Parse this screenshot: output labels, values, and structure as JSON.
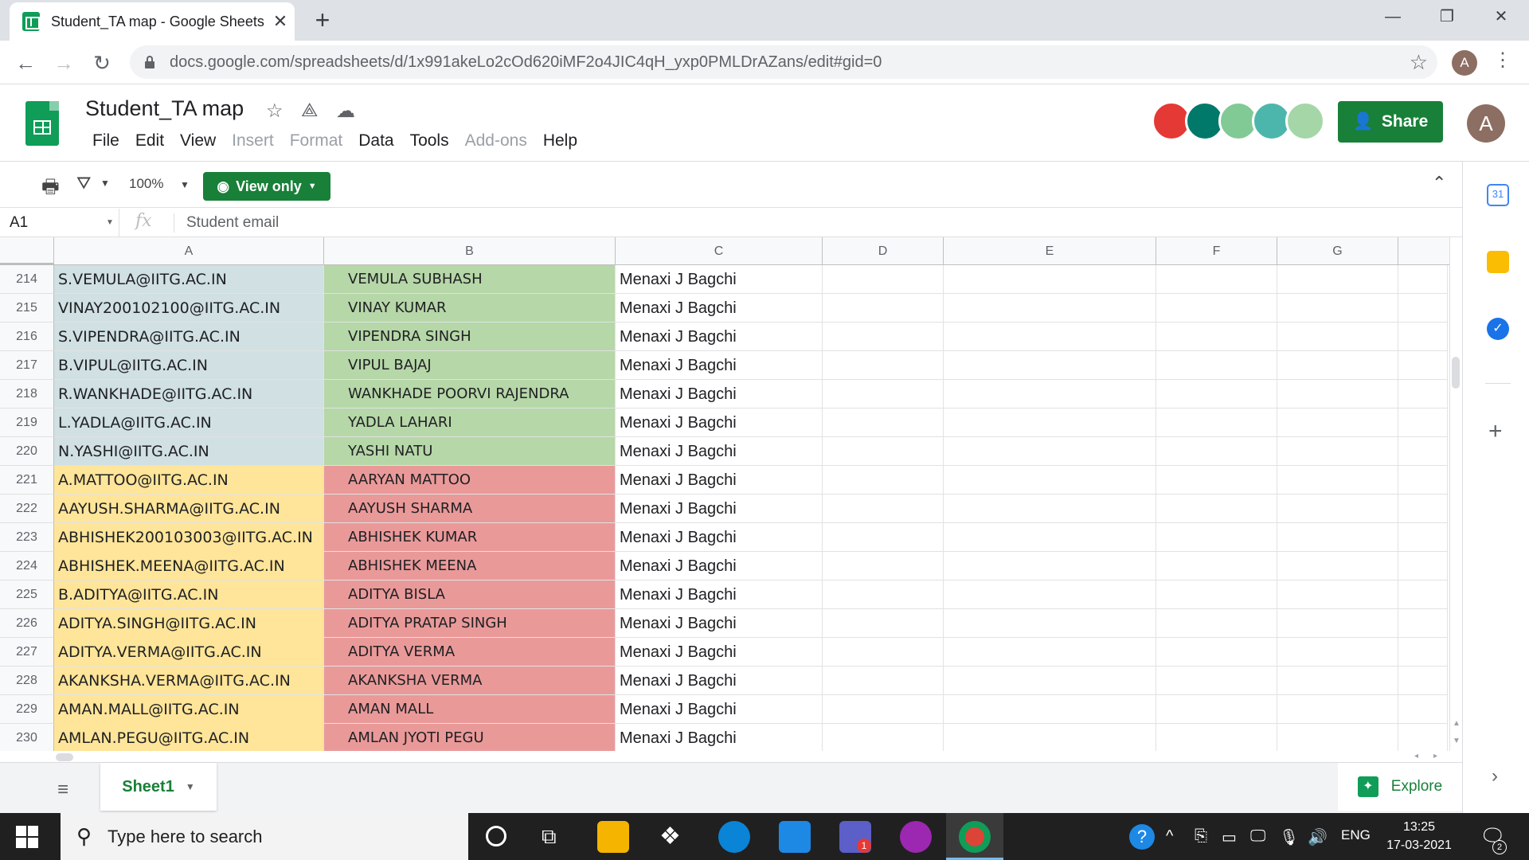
{
  "browser": {
    "tab_title": "Student_TA map - Google Sheets",
    "url": "docs.google.com/spreadsheets/d/1x991akeLo2cOd620iMF2o4JIC4qH_yxp0PMLDrAZans/edit#gid=0",
    "profile_initial": "A"
  },
  "doc": {
    "title": "Student_TA map",
    "menu": [
      "File",
      "Edit",
      "View",
      "Insert",
      "Format",
      "Data",
      "Tools",
      "Add-ons",
      "Help"
    ],
    "menu_disabled": [
      "Insert",
      "Format",
      "Add-ons"
    ],
    "share_label": "Share",
    "avatar_initial": "A",
    "collaborator_colors": [
      "#e53935",
      "#00796b",
      "#81c995",
      "#4db6ac",
      "#a5d6a7"
    ]
  },
  "toolbar": {
    "zoom": "100%",
    "view_only_label": "View only"
  },
  "formula_bar": {
    "cell_ref": "A1",
    "fx": "fx",
    "value": "Student email"
  },
  "grid": {
    "columns": [
      "A",
      "B",
      "C",
      "D",
      "E",
      "F",
      "G"
    ],
    "rows": [
      {
        "num": "214",
        "email": "S.VEMULA@IITG.AC.IN",
        "name": "VEMULA SUBHASH",
        "ta": "Menaxi J Bagchi",
        "group": "blue"
      },
      {
        "num": "215",
        "email": "VINAY200102100@IITG.AC.IN",
        "name": "VINAY KUMAR",
        "ta": "Menaxi J Bagchi",
        "group": "blue"
      },
      {
        "num": "216",
        "email": "S.VIPENDRA@IITG.AC.IN",
        "name": "VIPENDRA SINGH",
        "ta": "Menaxi J Bagchi",
        "group": "blue"
      },
      {
        "num": "217",
        "email": "B.VIPUL@IITG.AC.IN",
        "name": "VIPUL BAJAJ",
        "ta": "Menaxi J Bagchi",
        "group": "blue"
      },
      {
        "num": "218",
        "email": "R.WANKHADE@IITG.AC.IN",
        "name": "WANKHADE POORVI RAJENDRA",
        "ta": "Menaxi J Bagchi",
        "group": "blue"
      },
      {
        "num": "219",
        "email": "L.YADLA@IITG.AC.IN",
        "name": "YADLA LAHARI",
        "ta": "Menaxi J Bagchi",
        "group": "blue"
      },
      {
        "num": "220",
        "email": "N.YASHI@IITG.AC.IN",
        "name": "YASHI NATU",
        "ta": "Menaxi J Bagchi",
        "group": "blue"
      },
      {
        "num": "221",
        "email": "A.MATTOO@IITG.AC.IN",
        "name": "AARYAN MATTOO",
        "ta": "Menaxi J Bagchi",
        "group": "yellow"
      },
      {
        "num": "222",
        "email": "AAYUSH.SHARMA@IITG.AC.IN",
        "name": "AAYUSH SHARMA",
        "ta": "Menaxi J Bagchi",
        "group": "yellow"
      },
      {
        "num": "223",
        "email": "ABHISHEK200103003@IITG.AC.IN",
        "name": "ABHISHEK KUMAR",
        "ta": "Menaxi J Bagchi",
        "group": "yellow"
      },
      {
        "num": "224",
        "email": "ABHISHEK.MEENA@IITG.AC.IN",
        "name": "ABHISHEK MEENA",
        "ta": "Menaxi J Bagchi",
        "group": "yellow"
      },
      {
        "num": "225",
        "email": "B.ADITYA@IITG.AC.IN",
        "name": "ADITYA BISLA",
        "ta": "Menaxi J Bagchi",
        "group": "yellow"
      },
      {
        "num": "226",
        "email": "ADITYA.SINGH@IITG.AC.IN",
        "name": "ADITYA PRATAP SINGH",
        "ta": "Menaxi J Bagchi",
        "group": "yellow"
      },
      {
        "num": "227",
        "email": "ADITYA.VERMA@IITG.AC.IN",
        "name": "ADITYA VERMA",
        "ta": "Menaxi J Bagchi",
        "group": "yellow"
      },
      {
        "num": "228",
        "email": "AKANKSHA.VERMA@IITG.AC.IN",
        "name": "AKANKSHA VERMA",
        "ta": "Menaxi J Bagchi",
        "group": "yellow"
      },
      {
        "num": "229",
        "email": "AMAN.MALL@IITG.AC.IN",
        "name": "AMAN MALL",
        "ta": "Menaxi J Bagchi",
        "group": "yellow"
      },
      {
        "num": "230",
        "email": "AMLAN.PEGU@IITG.AC.IN",
        "name": "AMLAN JYOTI PEGU",
        "ta": "Menaxi J Bagchi",
        "group": "yellow"
      }
    ],
    "group_colors": {
      "blue": {
        "email_bg": "#d0e0e3",
        "name_bg": "#b6d7a8"
      },
      "yellow": {
        "email_bg": "#ffe599",
        "name_bg": "#ea9999"
      }
    }
  },
  "sheets": {
    "active_tab": "Sheet1",
    "explore_label": "Explore"
  },
  "taskbar": {
    "search_placeholder": "Type here to search",
    "lang": "ENG",
    "time": "13:25",
    "date": "17-03-2021",
    "notification_count": "2",
    "teams_badge": "1"
  }
}
